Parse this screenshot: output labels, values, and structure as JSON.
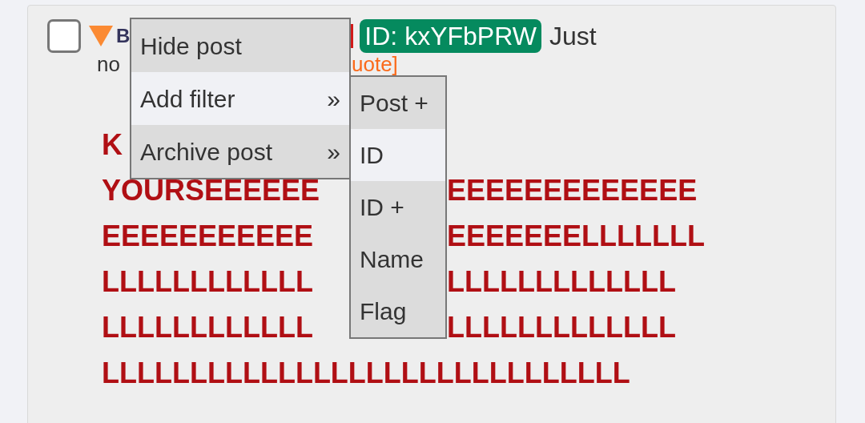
{
  "post": {
    "checked": false,
    "name": "B",
    "id_badge": "ID: kxYFbPRW",
    "text_after_id": "Just",
    "text_line_2": "no",
    "quote_link": "uote]",
    "lines": [
      {
        "left": "K"
      },
      {
        "left": "YOURSEEEEEE",
        "right": "EEEEEEEEEEEEE"
      },
      {
        "left": "EEEEEEEEEEE",
        "right": "EEEEEEELLLLLLL"
      },
      {
        "left": "LLLLLLLLLLLL",
        "right": "LLLLLLLLLLLLL"
      },
      {
        "left": "LLLLLLLLLLLL",
        "right": "LLLLLLLLLLLLL"
      },
      {
        "left": "LLLLLLLLLLLLLLLLLLLLLLLLLLLLLL"
      }
    ]
  },
  "menu": {
    "items": [
      {
        "label": "Hide post",
        "selected": false
      },
      {
        "label": "Add filter",
        "arrow": "»",
        "selected": true
      },
      {
        "label": "Archive post",
        "arrow": "»",
        "selected": false
      }
    ]
  },
  "submenu": {
    "items": [
      {
        "label": "Post +",
        "selected": false
      },
      {
        "label": "ID",
        "selected": true
      },
      {
        "label": "ID +",
        "selected": false
      },
      {
        "label": "Name",
        "selected": false
      },
      {
        "label": "Flag",
        "selected": false
      }
    ]
  }
}
